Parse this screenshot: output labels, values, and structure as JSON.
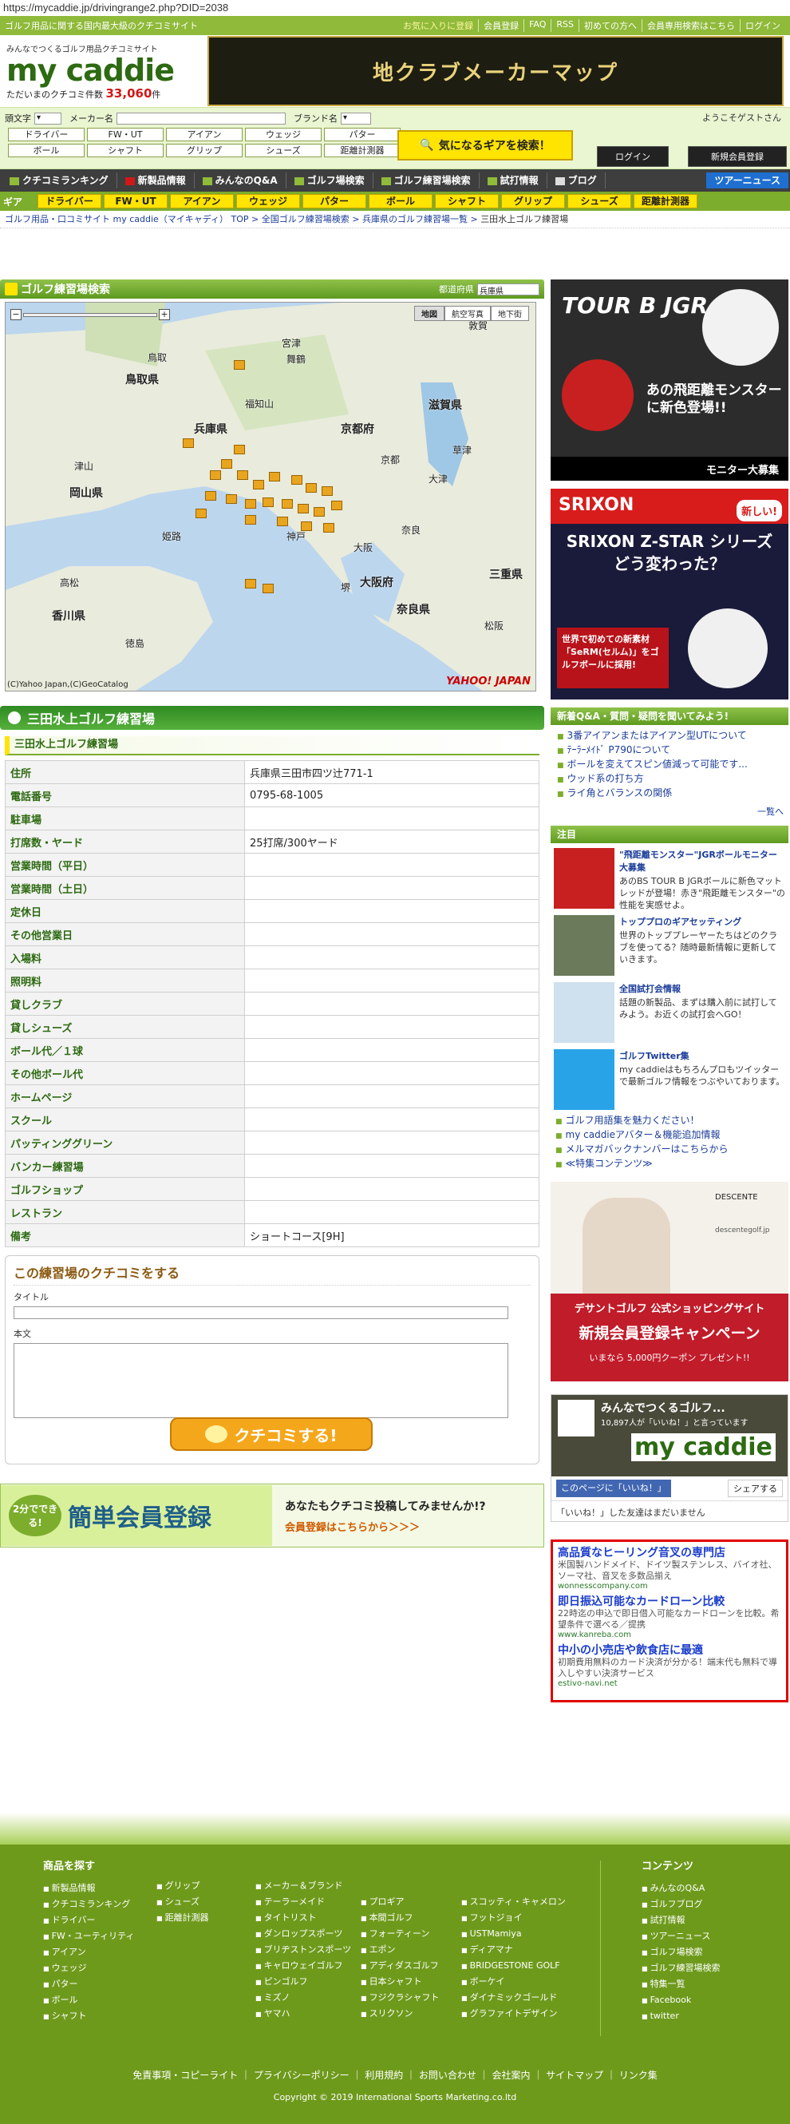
{
  "url": "https://mycaddie.jp/drivingrange2.php?DID=2038",
  "topbar": {
    "tagline": "ゴルフ用品に関する国内最大級のクチコミサイト",
    "links": [
      "お気に入りに登録",
      "会員登録",
      "FAQ",
      "RSS",
      "初めての方へ",
      "会員専用検索はこちら",
      "ログイン"
    ]
  },
  "header": {
    "logo_tag": "みんなでつくるゴルフ用品クチコミサイト",
    "logo": "my caddie",
    "count_label": "ただいまのクチコミ件数",
    "count": "33,060",
    "count_unit": "件",
    "banner": "地クラブメーカーマップ"
  },
  "search": {
    "row_labels": [
      "頭文字",
      "メーカー名",
      "ブランド名"
    ],
    "row1": [
      "ドライバー",
      "FW・UT",
      "アイアン",
      "ウェッジ",
      "パター"
    ],
    "row2": [
      "ボール",
      "シャフト",
      "グリップ",
      "シューズ",
      "距離計測器"
    ],
    "button": "気になるギアを検索！",
    "welcome": "ようこそゲストさん",
    "login": "ログイン",
    "register": "新規会員登録"
  },
  "nav": {
    "items": [
      "クチコミランキング",
      "新製品情報",
      "みんなのQ&A",
      "ゴルフ場検索",
      "ゴルフ練習場検索",
      "試打情報",
      "ブログ"
    ],
    "tour": "ツアーニュース"
  },
  "gearbar": {
    "label": "ギア",
    "items": [
      "ドライバー",
      "FW・UT",
      "アイアン",
      "ウェッジ",
      "パター",
      "ボール",
      "シャフト",
      "グリップ",
      "シューズ",
      "距離計測器"
    ]
  },
  "breadcrumb": [
    "ゴルフ用品・口コミサイト my caddie（マイキャディ） TOP",
    "全国ゴルフ練習場検索",
    "兵庫県のゴルフ練習場一覧",
    "三田水上ゴルフ練習場"
  ],
  "map_panel": {
    "title": "ゴルフ練習場検索",
    "pref_label": "都道府県",
    "pref_value": "兵庫県",
    "tabs": [
      "地図",
      "航空写真",
      "地下街"
    ],
    "copyright": "(C)Yahoo Japan,(C)GeoCatalog",
    "brand": "YAHOO! JAPAN",
    "labels": [
      "鳥取",
      "鳥取県",
      "兵庫県",
      "京都府",
      "滋賀県",
      "岡山県",
      "京都",
      "大津",
      "津山",
      "神戸",
      "大阪",
      "大阪府",
      "奈良",
      "奈良県",
      "三重県",
      "姫路",
      "高松",
      "徳島",
      "香川県",
      "舞鶴",
      "福知山",
      "宮津",
      "敦賀",
      "草津",
      "堺",
      "松阪"
    ]
  },
  "facility": {
    "name": "三田水上ゴルフ練習場",
    "sub": "三田水上ゴルフ練習場",
    "rows": [
      {
        "k": "住所",
        "v": "兵庫県三田市四ツ辻771-1"
      },
      {
        "k": "電話番号",
        "v": "0795-68-1005"
      },
      {
        "k": "駐車場",
        "v": ""
      },
      {
        "k": "打席数・ヤード",
        "v": "25打席/300ヤード"
      },
      {
        "k": "営業時間（平日）",
        "v": ""
      },
      {
        "k": "営業時間（土日）",
        "v": ""
      },
      {
        "k": "定休日",
        "v": ""
      },
      {
        "k": "その他営業日",
        "v": ""
      },
      {
        "k": "入場料",
        "v": ""
      },
      {
        "k": "照明料",
        "v": ""
      },
      {
        "k": "貸しクラブ",
        "v": ""
      },
      {
        "k": "貸しシューズ",
        "v": ""
      },
      {
        "k": "ボール代／１球",
        "v": ""
      },
      {
        "k": "その他ボール代",
        "v": ""
      },
      {
        "k": "ホームページ",
        "v": ""
      },
      {
        "k": "スクール",
        "v": ""
      },
      {
        "k": "パッティンググリーン",
        "v": ""
      },
      {
        "k": "バンカー練習場",
        "v": ""
      },
      {
        "k": "ゴルフショップ",
        "v": ""
      },
      {
        "k": "レストラン",
        "v": ""
      },
      {
        "k": "備考",
        "v": "ショートコース[9H]"
      }
    ]
  },
  "review": {
    "title": "この練習場のクチコミをする",
    "title_label": "タイトル",
    "body_label": "本文",
    "submit": "クチコミする!"
  },
  "member": {
    "badge": "2分でできる!",
    "title": "簡単会員登録",
    "text": "あなたもクチコミ投稿してみませんか!?",
    "link": "会員登録はこちらから＞＞＞"
  },
  "ads": {
    "ad1_top": "TOUR B JGR",
    "ad1_mid": "あの飛距離モンスターに新色登場!!",
    "ad1_foot": "モニター大募集",
    "ad2_brand": "SRIXON",
    "ad2_badge": "新しい!",
    "ad2_title": "SRIXON Z-STAR シリーズ どう変わった？",
    "ad2_text": "世界で初めての新素材「SeRM(セルム)」をゴルフボールに採用!"
  },
  "qa": {
    "title": "新着Q&A・質問・疑問を聞いてみよう!",
    "items": [
      "3番アイアンまたはアイアン型UTについて",
      "ﾃｰﾗｰﾒｲﾄﾞ P790について",
      "ボールを変えてスピン値減って可能です...",
      "ウッド系の打ち方",
      "ライ角とバランスの関係"
    ],
    "more": "一覧へ"
  },
  "notice": {
    "title": "注目",
    "items": [
      {
        "t": "\"飛距離モンスター\"JGRボールモニター大募集",
        "b": "あのBS TOUR B JGRボールに新色マットレッドが登場！赤き\"飛距離モンスター\"の性能を実感せよ。"
      },
      {
        "t": "トッププロのギアセッティング",
        "b": "世界のトッププレーヤーたちはどのクラブを使ってる？随時最新情報に更新していきます。"
      },
      {
        "t": "全国試打会情報",
        "b": "話題の新製品、まずは購入前に試打してみよう。お近くの試打会へGO！"
      },
      {
        "t": "ゴルフTwitter集",
        "b": "my caddieはもちろんプロもツイッターで最新ゴルフ情報をつぶやいております。"
      }
    ],
    "links": [
      "ゴルフ用語集を魅力ください！",
      "my caddieアバター＆機能追加情報",
      "メルマガバックナンバーはこちらから",
      "≪特集コンテンツ≫"
    ]
  },
  "desc_ad": {
    "brand": "DESCENTE",
    "site": "descentegolf.jp",
    "line1": "デサントゴルフ 公式ショッピングサイト",
    "line2": "新規会員登録キャンペーン",
    "line3": "いまなら 5,000円クーポン プレゼント!!"
  },
  "fb": {
    "page_name": "みんなでつくるゴルフ...",
    "likes": "10,897人が「いいね！」と言っています",
    "logo": "my caddie",
    "like_btn": "このページに「いいね！」",
    "share": "シェアする",
    "foot": "「いいね！」した友達はまだいません"
  },
  "textads": [
    {
      "h": "高品質なヒーリング音叉の専門店",
      "d": "米国製ハンドメイド、ドイツ製ステンレス、バイオ社、ソーマ社、音叉を多数品揃え",
      "u": "wonnesscompany.com"
    },
    {
      "h": "即日振込可能なカードローン比較",
      "d": "22時迄の申込で即日借入可能なカードローンを比較。希望条件で選べる／提携",
      "u": "www.kanreba.com"
    },
    {
      "h": "中小の小売店や飲食店に最適",
      "d": "初期費用無料のカード決済が分かる！端末代も無料で導入しやすい決済サービス",
      "u": "estivo-navi.net"
    }
  ],
  "footer": {
    "products_title": "商品を探す",
    "col1": [
      "新製品情報",
      "クチコミランキング",
      "ドライバー",
      "FW・ユーティリティ",
      "アイアン",
      "ウェッジ",
      "パター",
      "ボール",
      "シャフト"
    ],
    "col2": [
      "グリップ",
      "シューズ",
      "距離計測器"
    ],
    "col3_title": "メーカー＆ブランド",
    "col3": [
      "テーラーメイド",
      "タイトリスト",
      "ダンロップスポーツ",
      "ブリヂストンスポーツ",
      "キャロウェイゴルフ",
      "ピンゴルフ",
      "ミズノ",
      "ヤマハ"
    ],
    "col4": [
      "プロギア",
      "本間ゴルフ",
      "フォーティーン",
      "エポン",
      "アディダスゴルフ",
      "日本シャフト",
      "フジクラシャフト",
      "スリクソン"
    ],
    "col5": [
      "スコッティ・キャメロン",
      "フットジョイ",
      "USTMamiya",
      "ディアマナ",
      "BRIDGESTONE GOLF",
      "ボーケイ",
      "ダイナミックゴールド",
      "グラファイトデザイン"
    ],
    "contents_title": "コンテンツ",
    "contents": [
      "みんなのQ&A",
      "ゴルフブログ",
      "試打情報",
      "ツアーニュース",
      "ゴルフ場検索",
      "ゴルフ練習場検索",
      "特集一覧",
      "Facebook",
      "twitter"
    ],
    "links": "免責事項・コピーライト ｜ プライバシーポリシー ｜ 利用規約 ｜ お問い合わせ ｜ 会社案内 ｜ サイトマップ ｜ リンク集",
    "copyright": "Copyright © 2019 International Sports Marketing.co.ltd"
  },
  "colors": {
    "accent": "#7cad2c",
    "header_dark": "#3e3e3e",
    "yellow": "#ffe400"
  }
}
